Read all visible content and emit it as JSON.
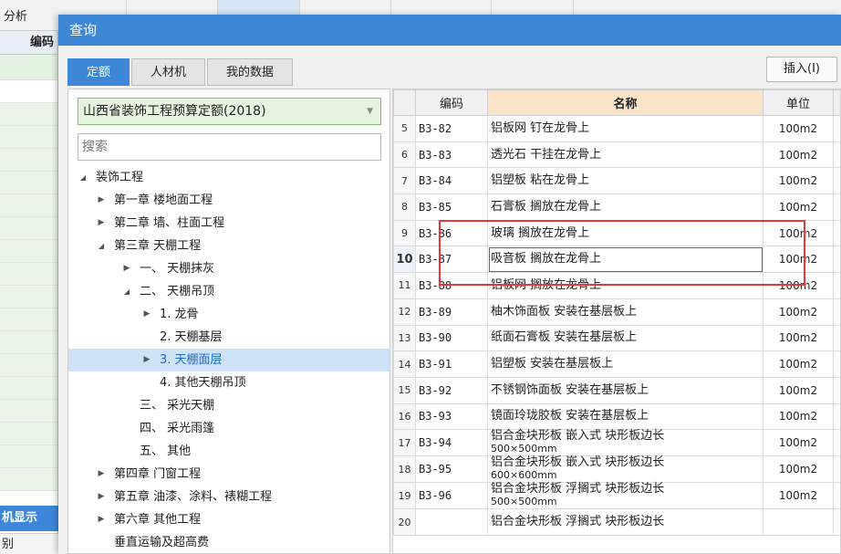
{
  "background": {
    "top_tab": "分析",
    "column_header": "编码",
    "bottom_label": "机显示",
    "bottom_label2": "别"
  },
  "dialog": {
    "title": "查询",
    "tabs": [
      "定额",
      "人材机",
      "我的数据"
    ],
    "insert_button": "插入(I)",
    "quota_select": "山西省装饰工程预算定额(2018)",
    "search_placeholder": "搜索"
  },
  "tree": [
    {
      "label": "装饰工程",
      "level": 0,
      "arrow": "expanded"
    },
    {
      "label": "第一章 楼地面工程",
      "level": 1,
      "arrow": "collapsed"
    },
    {
      "label": "第二章 墙、柱面工程",
      "level": 1,
      "arrow": "collapsed"
    },
    {
      "label": "第三章 天棚工程",
      "level": 1,
      "arrow": "expanded"
    },
    {
      "label": "一、 天棚抹灰",
      "level": 2,
      "arrow": "collapsed"
    },
    {
      "label": "二、 天棚吊顶",
      "level": 2,
      "arrow": "expanded"
    },
    {
      "label": "1. 龙骨",
      "level": 3,
      "arrow": "collapsed"
    },
    {
      "label": "2. 天棚基层",
      "level": 3,
      "arrow": "none"
    },
    {
      "label": "3. 天棚面层",
      "level": 3,
      "arrow": "collapsed",
      "selected": true
    },
    {
      "label": "4. 其他天棚吊顶",
      "level": 3,
      "arrow": "none"
    },
    {
      "label": "三、 采光天棚",
      "level": 2,
      "arrow": "none"
    },
    {
      "label": "四、 采光雨篷",
      "level": 2,
      "arrow": "none"
    },
    {
      "label": "五、 其他",
      "level": 2,
      "arrow": "none"
    },
    {
      "label": "第四章 门窗工程",
      "level": 1,
      "arrow": "collapsed"
    },
    {
      "label": "第五章 油漆、涂料、裱糊工程",
      "level": 1,
      "arrow": "collapsed"
    },
    {
      "label": "第六章 其他工程",
      "level": 1,
      "arrow": "collapsed"
    },
    {
      "label": "垂直运输及超高费",
      "level": 1,
      "arrow": "none"
    }
  ],
  "table": {
    "headers": {
      "num": "",
      "code": "编码",
      "name": "名称",
      "unit": "单位"
    },
    "rows": [
      {
        "num": "5",
        "code": "B3-82",
        "name": "铝板网 钉在龙骨上",
        "sub": "",
        "unit": "100m2"
      },
      {
        "num": "6",
        "code": "B3-83",
        "name": "透光石 干挂在龙骨上",
        "sub": "",
        "unit": "100m2"
      },
      {
        "num": "7",
        "code": "B3-84",
        "name": "铝塑板 粘在龙骨上",
        "sub": "",
        "unit": "100m2"
      },
      {
        "num": "8",
        "code": "B3-85",
        "name": "石膏板 搁放在龙骨上",
        "sub": "",
        "unit": "100m2"
      },
      {
        "num": "9",
        "code": "B3-86",
        "name": "玻璃 搁放在龙骨上",
        "sub": "",
        "unit": "100m2"
      },
      {
        "num": "10",
        "code": "B3-87",
        "name": "吸音板 搁放在龙骨上",
        "sub": "",
        "unit": "100m2",
        "current": true
      },
      {
        "num": "11",
        "code": "B3-88",
        "name": "铝板网 搁放在龙骨上",
        "sub": "",
        "unit": "100m2"
      },
      {
        "num": "12",
        "code": "B3-89",
        "name": "柚木饰面板 安装在基层板上",
        "sub": "",
        "unit": "100m2"
      },
      {
        "num": "13",
        "code": "B3-90",
        "name": "纸面石膏板 安装在基层板上",
        "sub": "",
        "unit": "100m2"
      },
      {
        "num": "14",
        "code": "B3-91",
        "name": "铝塑板 安装在基层板上",
        "sub": "",
        "unit": "100m2"
      },
      {
        "num": "15",
        "code": "B3-92",
        "name": "不锈钢饰面板 安装在基层板上",
        "sub": "",
        "unit": "100m2"
      },
      {
        "num": "16",
        "code": "B3-93",
        "name": "镜面玲珑胶板 安装在基层板上",
        "sub": "",
        "unit": "100m2"
      },
      {
        "num": "17",
        "code": "B3-94",
        "name": "铝合金块形板 嵌入式 块形板边长",
        "sub": "500×500mm",
        "unit": "100m2"
      },
      {
        "num": "18",
        "code": "B3-95",
        "name": "铝合金块形板 嵌入式 块形板边长",
        "sub": "600×600mm",
        "unit": "100m2"
      },
      {
        "num": "19",
        "code": "B3-96",
        "name": "铝合金块形板 浮搁式 块形板边长",
        "sub": "500×500mm",
        "unit": "100m2"
      },
      {
        "num": "20",
        "code": "",
        "name": "铝合金块形板 浮搁式 块形板边长",
        "sub": "",
        "unit": ""
      }
    ]
  },
  "colors": {
    "accent": "#3d87d6",
    "highlight_frame": "#e53a3a",
    "selected_node": "#cfe3f8"
  }
}
